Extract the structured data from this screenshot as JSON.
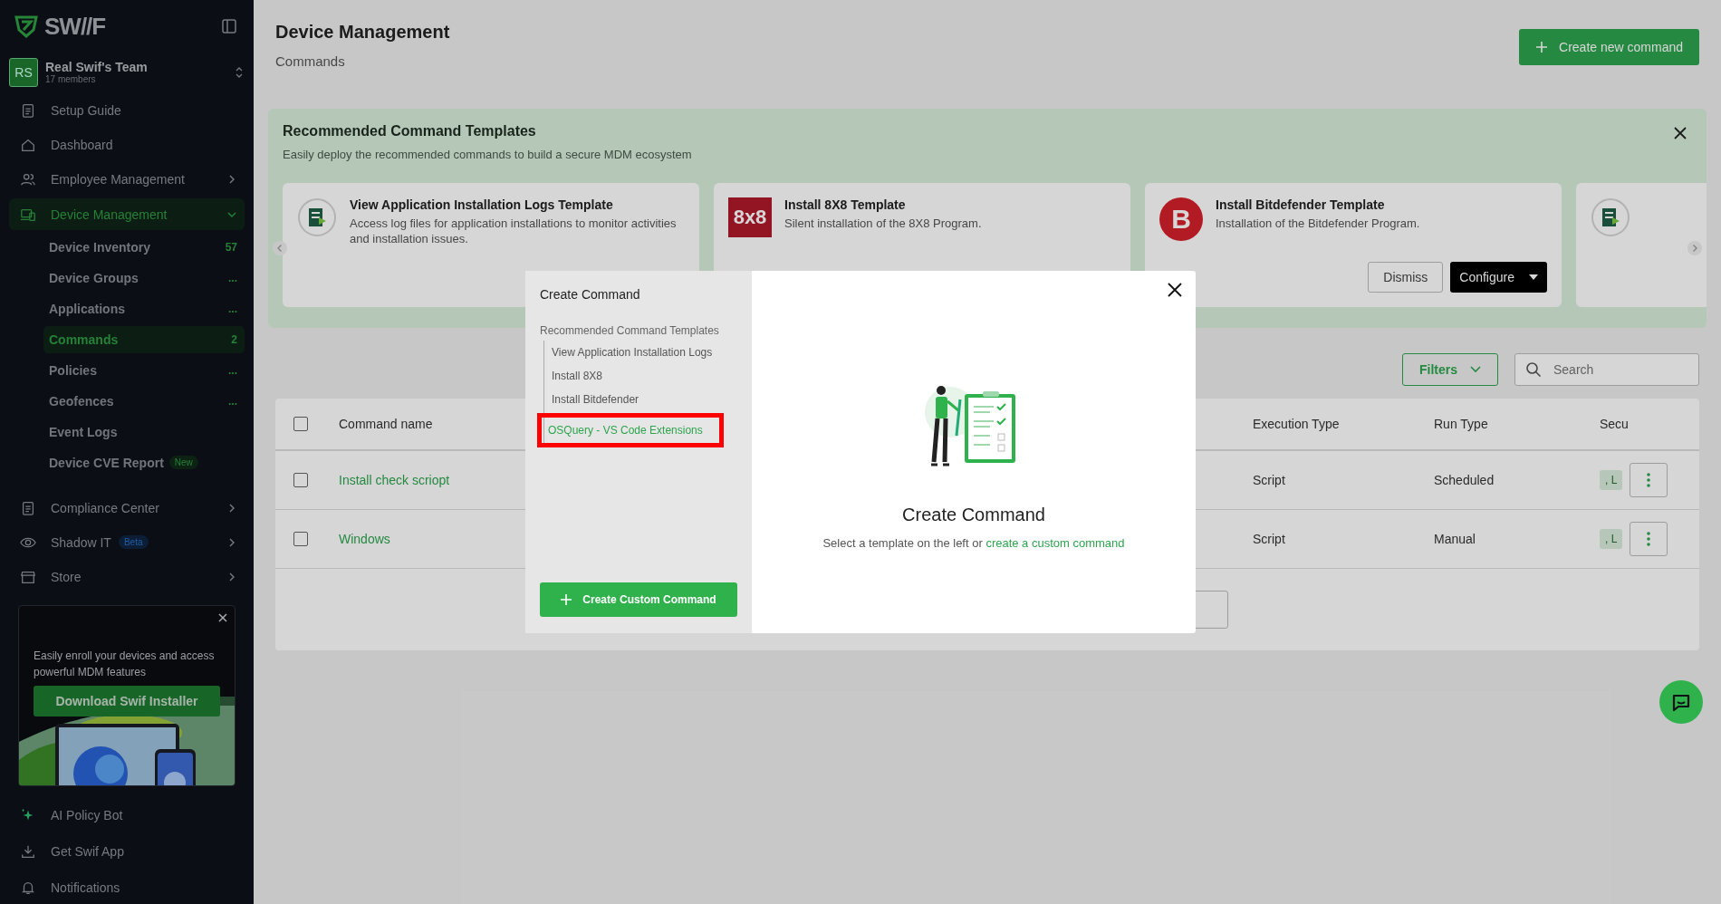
{
  "sidebar": {
    "brand": "SW//F",
    "team": {
      "initials": "RS",
      "name": "Real Swif's Team",
      "members": "17 members"
    },
    "items": [
      {
        "label": "Setup Guide",
        "selected": false
      },
      {
        "label": "Dashboard",
        "selected": false
      },
      {
        "label": "Employee Management",
        "selected": false,
        "expanded": false
      },
      {
        "label": "Device Management",
        "selected": true,
        "expanded": true,
        "children": [
          {
            "label": "Device Inventory",
            "count": "57",
            "selected": false
          },
          {
            "label": "Device Groups",
            "count": "...",
            "selected": false
          },
          {
            "label": "Applications",
            "count": "...",
            "selected": false
          },
          {
            "label": "Commands",
            "count": "2",
            "selected": true
          },
          {
            "label": "Policies",
            "count": "...",
            "selected": false
          },
          {
            "label": "Geofences",
            "count": "...",
            "selected": false
          },
          {
            "label": "Event Logs",
            "selected": false
          },
          {
            "label": "Device CVE Report",
            "tag": "New",
            "selected": false
          }
        ]
      },
      {
        "label": "Compliance Center",
        "selected": false,
        "expanded": false
      },
      {
        "label": "Shadow IT",
        "selected": false,
        "expanded": false,
        "tag": "Beta"
      },
      {
        "label": "Store",
        "selected": false,
        "expanded": false
      }
    ],
    "promo": {
      "text": "Easily enroll your devices and access powerful MDM features",
      "button": "Download Swif Installer"
    },
    "bottom_items": [
      {
        "label": "AI Policy Bot"
      },
      {
        "label": "Get Swif App"
      },
      {
        "label": "Notifications"
      }
    ]
  },
  "header": {
    "title": "Device Management",
    "subtitle": "Commands",
    "button": "Create new command"
  },
  "recommended": {
    "title": "Recommended Command Templates",
    "description": "Easily deploy the recommended commands to build a secure MDM ecosystem",
    "cards": [
      {
        "logo": {
          "kind": "logs"
        },
        "title": "View Application Installation Logs Template",
        "description": "Access log files for application installations to monitor activities and installation issues."
      },
      {
        "logo": {
          "kind": "square",
          "text": "8x8"
        },
        "title": "Install 8X8 Template",
        "description": "Silent installation of the 8X8 Program."
      },
      {
        "logo": {
          "kind": "circle",
          "text": "B"
        },
        "title": "Install Bitdefender Template",
        "description": "Installation of the Bitdefender Program.",
        "buttons": [
          "Dismiss",
          "Configure"
        ]
      },
      {
        "logo": {
          "kind": "logs"
        }
      }
    ]
  },
  "toolbar": {
    "filters": "Filters",
    "search_placeholder": "Search"
  },
  "table": {
    "columns": [
      "Command name",
      "Execution Type",
      "Run Type",
      "Secu"
    ],
    "all_checked": false,
    "rows": [
      {
        "name": "Install check scriopt",
        "execution_type": "Script",
        "run_type": "Scheduled",
        "security": ", L",
        "checked": false
      },
      {
        "name": "Windows",
        "execution_type": "Script",
        "run_type": "Manual",
        "security": ", L",
        "checked": false
      }
    ]
  },
  "modal": {
    "title": "Create Command",
    "section": "Recommended Command Templates",
    "templates": [
      {
        "label": "View Application Installation Logs",
        "selected": false,
        "highlighted": false
      },
      {
        "label": "Install 8X8",
        "selected": false,
        "highlighted": false
      },
      {
        "label": "Install Bitdefender",
        "selected": false,
        "highlighted": false
      },
      {
        "label": "OSQuery - VS Code Extensions",
        "selected": true,
        "highlighted": true
      }
    ],
    "custom_button": "Create Custom Command",
    "heading": "Create Command",
    "text": "Select a template on the left or ",
    "link": "create a custom command"
  }
}
